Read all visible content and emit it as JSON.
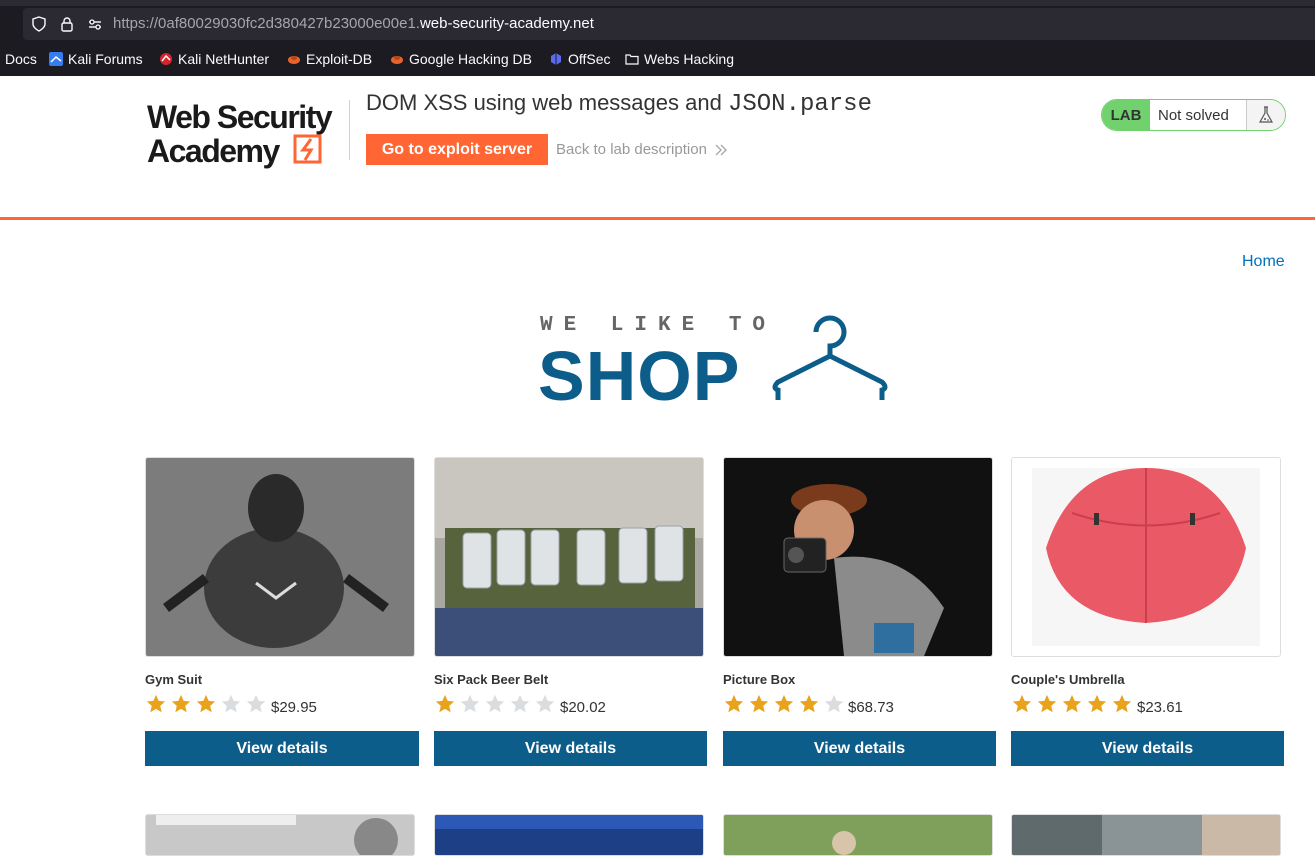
{
  "browser": {
    "url_dim_prefix": "https://0af80029030fc2d380427b23000e00e1.",
    "url_domain": "web-security-academy.net",
    "bookmarks": [
      {
        "label": "Docs",
        "icon": "none"
      },
      {
        "label": "Kali Forums",
        "icon": "kali-icon"
      },
      {
        "label": "Kali NetHunter",
        "icon": "nethunter-icon"
      },
      {
        "label": "Exploit-DB",
        "icon": "exploitdb-icon"
      },
      {
        "label": "Google Hacking DB",
        "icon": "ghdb-icon"
      },
      {
        "label": "OffSec",
        "icon": "offsec-icon"
      },
      {
        "label": "Webs Hacking",
        "icon": "folder-icon"
      }
    ]
  },
  "header": {
    "logo_line1": "Web Security",
    "logo_line2": "Academy",
    "title_prefix": "DOM XSS using web messages and ",
    "title_code": "JSON.parse",
    "exploit_button": "Go to exploit server",
    "back_link": "Back to lab description",
    "lab_badge": "LAB",
    "lab_status": "Not solved"
  },
  "nav": {
    "home": "Home"
  },
  "banner": {
    "line1": "WE LIKE TO",
    "line2": "SHOP"
  },
  "products": [
    {
      "name": "Gym Suit",
      "rating": 3,
      "price": "$29.95",
      "button": "View details"
    },
    {
      "name": "Six Pack Beer Belt",
      "rating": 1,
      "price": "$20.02",
      "button": "View details"
    },
    {
      "name": "Picture Box",
      "rating": 4,
      "price": "$68.73",
      "button": "View details"
    },
    {
      "name": "Couple's Umbrella",
      "rating": 5,
      "price": "$23.61",
      "button": "View details"
    }
  ],
  "colors": {
    "accent": "#ff6633",
    "button": "#0c5d8a",
    "link": "#0071bc",
    "lab_green": "#70d16d",
    "star": "#e8a21c"
  }
}
